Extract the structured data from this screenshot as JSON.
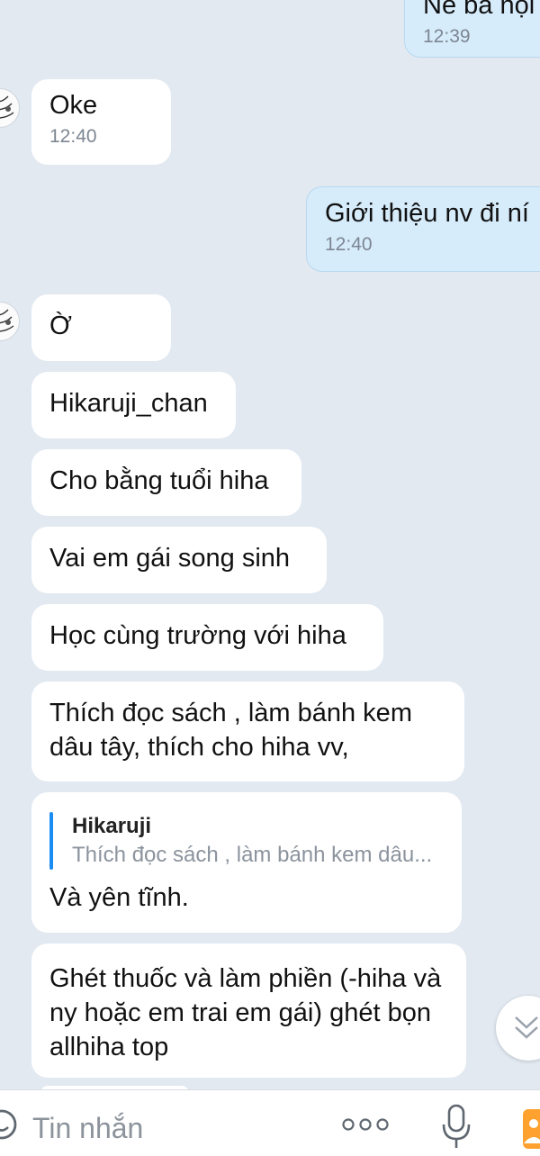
{
  "messages": [
    {
      "direction": "out",
      "text": "Nè bà nội",
      "time": "12:39"
    },
    {
      "direction": "in",
      "text": "Oke",
      "time": "12:40"
    },
    {
      "direction": "out",
      "text": "Giới thiệu nv đi ní",
      "time": "12:40"
    },
    {
      "direction": "in",
      "text": "Ờ"
    },
    {
      "direction": "in",
      "text": "Hikaruji_chan"
    },
    {
      "direction": "in",
      "text": "Cho bằng tuổi hiha"
    },
    {
      "direction": "in",
      "text": "Vai em gái song sinh"
    },
    {
      "direction": "in",
      "text": "Học cùng trường với hiha"
    },
    {
      "direction": "in",
      "text": "Thích đọc sách , làm bánh kem dâu tây, thích cho hiha vv,"
    },
    {
      "direction": "in",
      "quote": {
        "name": "Hikaruji",
        "text": "Thích đọc sách , làm bánh kem dâu..."
      },
      "text": "Và yên tĩnh."
    },
    {
      "direction": "in",
      "text": "Ghét thuốc và làm phiền (-hiha và ny hoặc em trai em gái) ghét bọn allhiha top"
    }
  ],
  "input_bar": {
    "placeholder": "Tin nhắn",
    "icons": [
      "sticker-icon",
      "more-icon",
      "microphone-icon",
      "image-icon"
    ]
  },
  "scroll_button": {
    "icon": "double-chevron-down-icon"
  },
  "colors": {
    "background": "#e2e9f1",
    "incoming_bubble": "#ffffff",
    "outgoing_bubble": "#d6ecfb",
    "quote_bar": "#1a8cf2",
    "timestamp": "#7d8692"
  }
}
